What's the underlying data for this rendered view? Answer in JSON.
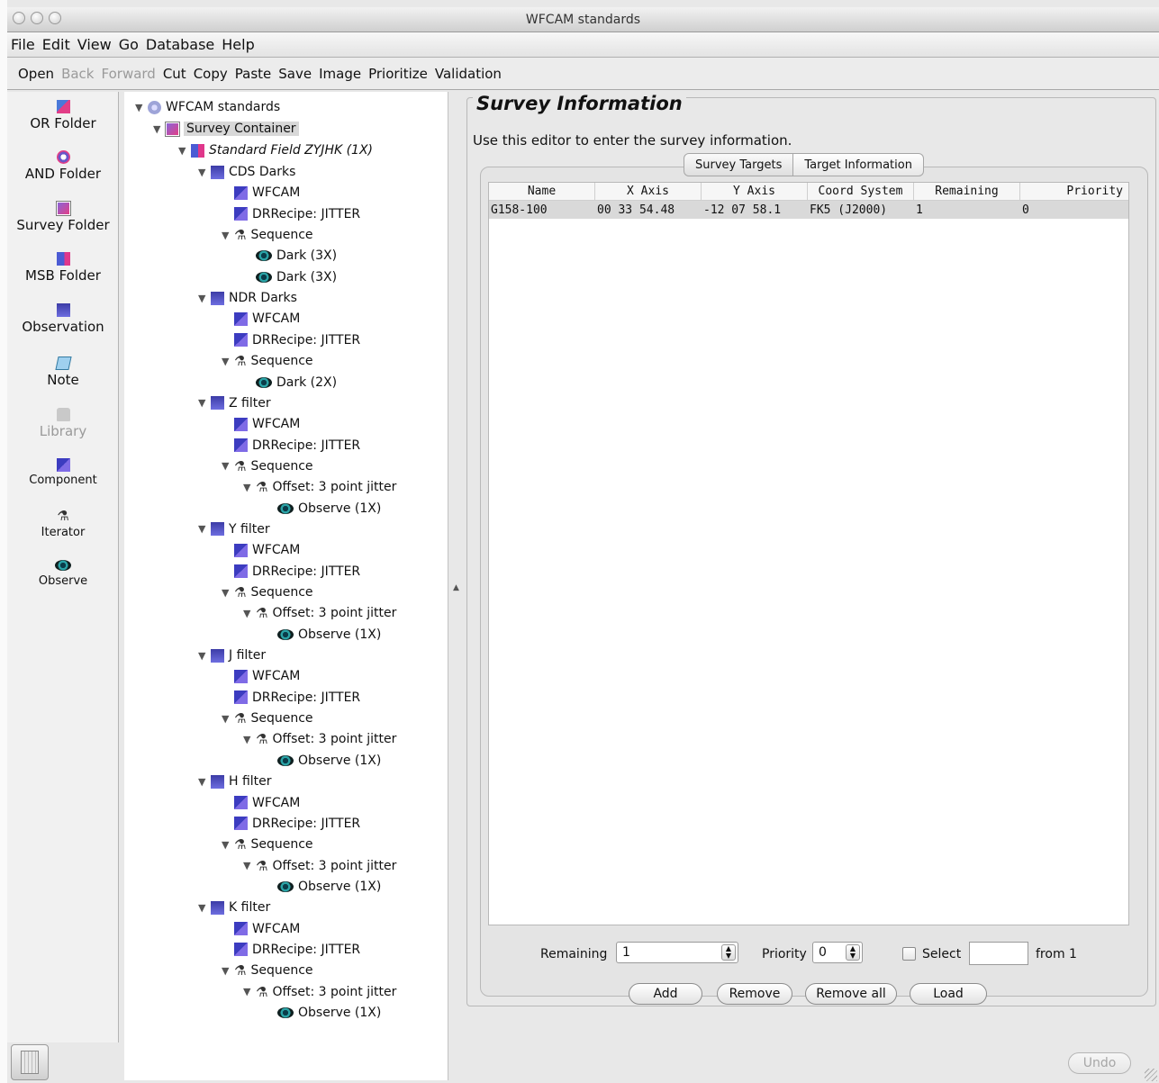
{
  "window": {
    "title": "WFCAM standards"
  },
  "menu": {
    "items": [
      "File",
      "Edit",
      "View",
      "Go",
      "Database",
      "Help"
    ]
  },
  "toolbar": {
    "items": [
      {
        "label": "Open",
        "enabled": true
      },
      {
        "label": "Back",
        "enabled": false
      },
      {
        "label": "Forward",
        "enabled": false
      },
      {
        "label": "Cut",
        "enabled": true
      },
      {
        "label": "Copy",
        "enabled": true
      },
      {
        "label": "Paste",
        "enabled": true
      },
      {
        "label": "Save",
        "enabled": true
      },
      {
        "label": "Image",
        "enabled": true
      },
      {
        "label": "Prioritize",
        "enabled": true
      },
      {
        "label": "Validation",
        "enabled": true
      }
    ]
  },
  "palette": {
    "items": [
      {
        "label": "OR Folder",
        "icon": "or-folder-icon"
      },
      {
        "label": "AND Folder",
        "icon": "and-folder-icon"
      },
      {
        "label": "Survey Folder",
        "icon": "survey-folder-icon"
      },
      {
        "label": "MSB Folder",
        "icon": "msb-folder-icon"
      },
      {
        "label": "Observation",
        "icon": "observation-icon"
      },
      {
        "label": "Note",
        "icon": "note-icon"
      },
      {
        "label": "Library",
        "icon": "library-icon",
        "disabled": true
      },
      {
        "label": "Component",
        "icon": "component-icon"
      },
      {
        "label": "Iterator",
        "icon": "iterator-icon"
      },
      {
        "label": "Observe",
        "icon": "observe-icon"
      }
    ]
  },
  "tree": {
    "root": "WFCAM standards",
    "survey_container": "Survey Container",
    "msb": "Standard Field ZYJHK (1X)",
    "nodes": [
      {
        "label": "CDS Darks",
        "level": 3,
        "icon": "observation-icon",
        "expanded": true
      },
      {
        "label": "WFCAM",
        "level": 4,
        "icon": "component-icon"
      },
      {
        "label": "DRRecipe: JITTER",
        "level": 4,
        "icon": "component-icon"
      },
      {
        "label": "Sequence",
        "level": 4,
        "icon": "iterator-icon",
        "expanded": true
      },
      {
        "label": "Dark (3X)",
        "level": 5,
        "icon": "observe-icon"
      },
      {
        "label": "Dark (3X)",
        "level": 5,
        "icon": "observe-icon"
      },
      {
        "label": "NDR Darks",
        "level": 3,
        "icon": "observation-icon",
        "expanded": true
      },
      {
        "label": "WFCAM",
        "level": 4,
        "icon": "component-icon"
      },
      {
        "label": "DRRecipe: JITTER",
        "level": 4,
        "icon": "component-icon"
      },
      {
        "label": "Sequence",
        "level": 4,
        "icon": "iterator-icon",
        "expanded": true
      },
      {
        "label": "Dark (2X)",
        "level": 5,
        "icon": "observe-icon"
      },
      {
        "label": "Z filter",
        "level": 3,
        "icon": "observation-icon",
        "expanded": true
      },
      {
        "label": "WFCAM",
        "level": 4,
        "icon": "component-icon"
      },
      {
        "label": "DRRecipe: JITTER",
        "level": 4,
        "icon": "component-icon"
      },
      {
        "label": "Sequence",
        "level": 4,
        "icon": "iterator-icon",
        "expanded": true
      },
      {
        "label": "Offset: 3 point jitter",
        "level": 5,
        "icon": "iterator-icon",
        "expanded": true
      },
      {
        "label": "Observe (1X)",
        "level": 6,
        "icon": "observe-icon"
      },
      {
        "label": "Y filter",
        "level": 3,
        "icon": "observation-icon",
        "expanded": true
      },
      {
        "label": "WFCAM",
        "level": 4,
        "icon": "component-icon"
      },
      {
        "label": "DRRecipe: JITTER",
        "level": 4,
        "icon": "component-icon"
      },
      {
        "label": "Sequence",
        "level": 4,
        "icon": "iterator-icon",
        "expanded": true
      },
      {
        "label": "Offset: 3 point jitter",
        "level": 5,
        "icon": "iterator-icon",
        "expanded": true
      },
      {
        "label": "Observe (1X)",
        "level": 6,
        "icon": "observe-icon"
      },
      {
        "label": "J filter",
        "level": 3,
        "icon": "observation-icon",
        "expanded": true
      },
      {
        "label": "WFCAM",
        "level": 4,
        "icon": "component-icon"
      },
      {
        "label": "DRRecipe: JITTER",
        "level": 4,
        "icon": "component-icon"
      },
      {
        "label": "Sequence",
        "level": 4,
        "icon": "iterator-icon",
        "expanded": true
      },
      {
        "label": "Offset: 3 point jitter",
        "level": 5,
        "icon": "iterator-icon",
        "expanded": true
      },
      {
        "label": "Observe (1X)",
        "level": 6,
        "icon": "observe-icon"
      },
      {
        "label": "H filter",
        "level": 3,
        "icon": "observation-icon",
        "expanded": true
      },
      {
        "label": "WFCAM",
        "level": 4,
        "icon": "component-icon"
      },
      {
        "label": "DRRecipe: JITTER",
        "level": 4,
        "icon": "component-icon"
      },
      {
        "label": "Sequence",
        "level": 4,
        "icon": "iterator-icon",
        "expanded": true
      },
      {
        "label": "Offset: 3 point jitter",
        "level": 5,
        "icon": "iterator-icon",
        "expanded": true
      },
      {
        "label": "Observe (1X)",
        "level": 6,
        "icon": "observe-icon"
      },
      {
        "label": "K filter",
        "level": 3,
        "icon": "observation-icon",
        "expanded": true
      },
      {
        "label": "WFCAM",
        "level": 4,
        "icon": "component-icon"
      },
      {
        "label": "DRRecipe: JITTER",
        "level": 4,
        "icon": "component-icon"
      },
      {
        "label": "Sequence",
        "level": 4,
        "icon": "iterator-icon",
        "expanded": true
      },
      {
        "label": "Offset: 3 point jitter",
        "level": 5,
        "icon": "iterator-icon",
        "expanded": true
      },
      {
        "label": "Observe (1X)",
        "level": 6,
        "icon": "observe-icon"
      }
    ]
  },
  "editor": {
    "title": "Survey Information",
    "description": "Use this editor to enter the survey information.",
    "tabs": [
      {
        "label": "Survey Targets",
        "active": true
      },
      {
        "label": "Target Information",
        "active": false
      }
    ],
    "table": {
      "columns": [
        "Name",
        "X Axis",
        "Y Axis",
        "Coord System",
        "Remaining",
        "Priority"
      ],
      "rows": [
        [
          "G158-100",
          "00 33 54.48",
          "-12 07 58.1",
          "FK5 (J2000)",
          "1",
          "0"
        ]
      ]
    },
    "controls": {
      "remaining_label": "Remaining",
      "remaining_value": "1",
      "priority_label": "Priority",
      "priority_value": "0",
      "select_label": "Select",
      "select_value": "",
      "from_label": "from 1"
    },
    "buttons": {
      "add": "Add",
      "remove": "Remove",
      "remove_all": "Remove all",
      "load": "Load"
    }
  },
  "undo_label": "Undo"
}
